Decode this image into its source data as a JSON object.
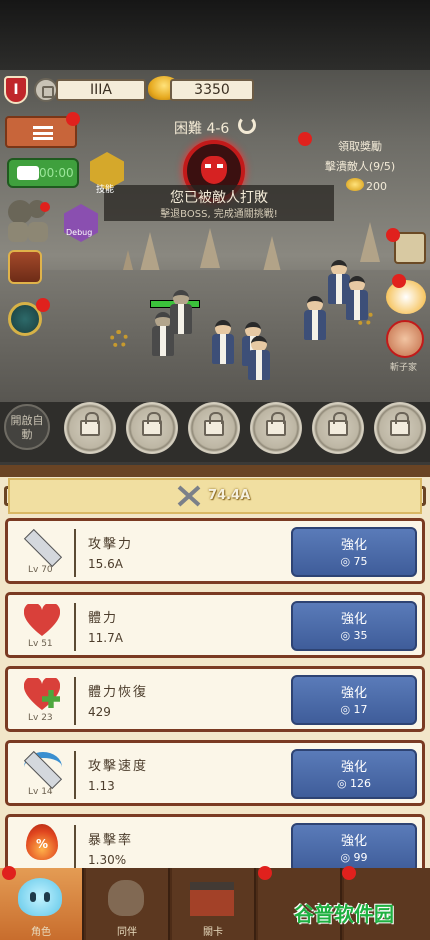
{
  "resources": {
    "rank": "IIIA",
    "gold": "3350"
  },
  "stage": {
    "label": "困難 4-6"
  },
  "defeat": {
    "title": "您已被敵人打敗",
    "subtitle": "擊退BOSS, 完成通關挑戰!"
  },
  "quest": {
    "title": "領取獎勵",
    "task": "擊潰敵人(9/5)",
    "reward": "200"
  },
  "left_buttons": {
    "speed_label": "00:00",
    "skill_label": "技能",
    "debug_label": "Debug"
  },
  "right_buttons": {
    "face_label": "斬子家"
  },
  "skills": {
    "auto_label": "開啟自動"
  },
  "panel": {
    "total_attack": "74.4A"
  },
  "upgrades": [
    {
      "name": "攻擊力",
      "level": "Lv 70",
      "value": "15.6A",
      "button": "強化",
      "cost": "◎ 75",
      "icon": "sword-icon"
    },
    {
      "name": "體力",
      "level": "Lv 51",
      "value": "11.7A",
      "button": "強化",
      "cost": "◎ 35",
      "icon": "heart-icon"
    },
    {
      "name": "體力恢復",
      "level": "Lv 23",
      "value": "429",
      "button": "強化",
      "cost": "◎ 17",
      "icon": "heart-plus-icon"
    },
    {
      "name": "攻擊速度",
      "level": "Lv 14",
      "value": "1.13",
      "button": "強化",
      "cost": "◎ 126",
      "icon": "fast-sword-icon"
    },
    {
      "name": "暴擊率",
      "level": "",
      "value": "1.30%",
      "button": "強化",
      "cost": "◎ 99",
      "icon": "crit-icon"
    }
  ],
  "nav": [
    {
      "label": "角色",
      "icon": "slime-icon"
    },
    {
      "label": "同伴",
      "icon": "cat-icon"
    },
    {
      "label": "關卡",
      "icon": "gate-icon"
    },
    {
      "label": "",
      "icon": "pagoda-icon"
    },
    {
      "label": "",
      "icon": "shop-icon"
    }
  ],
  "watermark": "谷普软件园",
  "colors": {
    "upgrade_button": "#4a6aa8",
    "card_border": "#7a3a22",
    "active_tab": "#d9843e"
  }
}
